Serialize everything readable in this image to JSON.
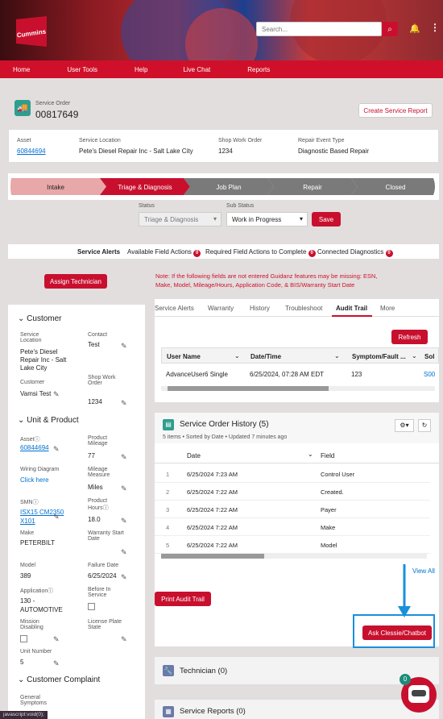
{
  "header": {
    "search_placeholder": "Search...",
    "brand": "Cummins"
  },
  "nav": [
    "Home",
    "User Tools",
    "Help",
    "Live Chat",
    "Reports"
  ],
  "service_order": {
    "label": "Service Order",
    "number": "00817649",
    "create_report": "Create Service Report"
  },
  "summary": {
    "asset_label": "Asset",
    "asset": "60844694",
    "location_label": "Service Location",
    "location": "Pete's Diesel Repair Inc - Salt Lake City",
    "shop_label": "Shop Work Order",
    "shop": "1234",
    "repair_label": "Repair Event Type",
    "repair": "Diagnostic Based Repair"
  },
  "path": [
    "Intake",
    "Triage & Diagnosis",
    "Job Plan",
    "Repair",
    "Closed"
  ],
  "status": {
    "status_label": "Status",
    "status": "Triage & Diagnosis",
    "sub_label": "Sub Status",
    "sub": "Work in Progress",
    "save": "Save"
  },
  "alerts": {
    "title": "Service Alerts",
    "items": [
      {
        "label": "Available Field Actions",
        "count": "0"
      },
      {
        "label": "Required Field Actions to Complete",
        "count": "0"
      },
      {
        "label": "Connected Diagnostics",
        "count": "0"
      }
    ]
  },
  "assign": "Assign Technician",
  "note": "Note: If the following fields are not entered Guidanz features may be missing: ESN, Make, Model, Mileage/Hours, Application Code, & BIS/Warranty Start Date",
  "customer": {
    "section": "Customer",
    "loc_label": "Service Location",
    "loc": "Pete's Diesel Repair Inc - Salt Lake City",
    "contact_label": "Contact",
    "contact": "Test",
    "cust_label": "Customer",
    "cust": "Vamsi Test",
    "shop_label": "Shop Work Order",
    "shop": "1234"
  },
  "unit": {
    "section": "Unit & Product",
    "asset_label": "Asset",
    "asset": "60844694",
    "mileage_label": "Product Mileage",
    "mileage": "77",
    "wiring_label": "Wiring Diagram",
    "wiring": "Click here",
    "measure_label": "Mileage Measure",
    "measure": "Miles",
    "esn_label": "SMN",
    "esn": "ISX15 CM2350 X101",
    "hours_label": "Product Hours",
    "hours": "18.0",
    "make_label": "Make",
    "make": "PETERBILT",
    "warranty_label": "Warranty Start Date",
    "model_label": "Model",
    "model": "389",
    "failure_label": "Failure Date",
    "failure": "6/25/2024",
    "app_label": "Application",
    "app": "130 - AUTOMOTIVE",
    "before_label": "Before In Service",
    "mission_label": "Mission Disabling",
    "plate_label": "License Plate State",
    "unitnum_label": "Unit Number",
    "unitnum": "5"
  },
  "complaint": {
    "section": "Customer Complaint",
    "general_label": "General Symptoms"
  },
  "tabs": [
    "Service Alerts",
    "Warranty",
    "History",
    "Troubleshoot",
    "Audit Trail",
    "More"
  ],
  "audit": {
    "refresh": "Refresh",
    "columns": [
      "User Name",
      "Date/Time",
      "Symptom/Fault ...",
      "Sol"
    ],
    "row": [
      "AdvanceUser6 Single",
      "6/25/2024, 07:28 AM EDT",
      "123",
      "S00"
    ]
  },
  "history": {
    "title": "Service Order History (5)",
    "meta": "5 items • Sorted by Date • Updated 7 minutes ago",
    "columns": [
      "Date",
      "Field"
    ],
    "rows": [
      {
        "n": "1",
        "date": "6/25/2024 7:23 AM",
        "field": "Control User"
      },
      {
        "n": "2",
        "date": "6/25/2024 7:22 AM",
        "field": "Created."
      },
      {
        "n": "3",
        "date": "6/25/2024 7:22 AM",
        "field": "Payer"
      },
      {
        "n": "4",
        "date": "6/25/2024 7:22 AM",
        "field": "Make"
      },
      {
        "n": "5",
        "date": "6/25/2024 7:22 AM",
        "field": "Model"
      }
    ],
    "view_all": "View All"
  },
  "print_audit": "Print Audit Trail",
  "ask": "Ask Clessie/Chatbot",
  "technician": "Technician (0)",
  "service_reports": "Service Reports (0)",
  "chat_badge": "0",
  "status_url": "javascript:void(0);",
  "colors": {
    "red": "#c8102e",
    "link": "#0070d2",
    "highlight": "#1a8fdc"
  }
}
